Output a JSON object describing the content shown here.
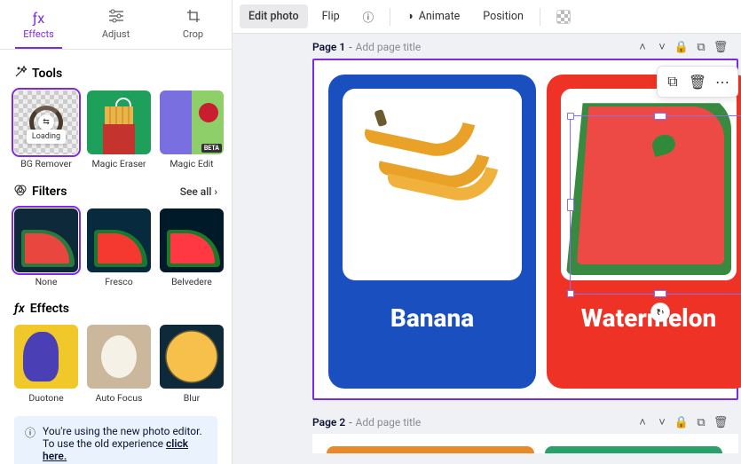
{
  "tabs": {
    "effects": "Effects",
    "adjust": "Adjust",
    "crop": "Crop"
  },
  "sections": {
    "tools": "Tools",
    "filters": "Filters",
    "effects": "Effects"
  },
  "see_all": "See all",
  "tools": {
    "bg_remover": "BG Remover",
    "bg_remover_status": "Loading",
    "magic_eraser": "Magic Eraser",
    "magic_edit": "Magic Edit",
    "magic_edit_badge": "BETA"
  },
  "filter_items": {
    "none": "None",
    "fresco": "Fresco",
    "belvedere": "Belvedere"
  },
  "fx_items": {
    "duotone": "Duotone",
    "auto_focus": "Auto Focus",
    "blur": "Blur"
  },
  "notice": {
    "line1": "You're using the new photo editor.",
    "line2_a": "To use the old experience ",
    "line2_link": "click here."
  },
  "toolbar": {
    "edit_photo": "Edit photo",
    "flip": "Flip",
    "animate": "Animate",
    "position": "Position"
  },
  "pages": {
    "p1_label": "Page 1",
    "p2_label": "Page 2",
    "title_placeholder": "Add page title"
  },
  "cards": {
    "banana": "Banana",
    "watermelon": "Watermelon"
  }
}
